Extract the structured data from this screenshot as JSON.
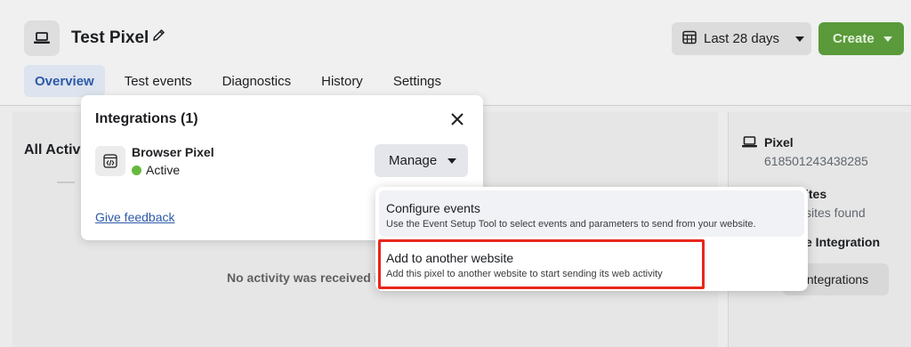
{
  "header": {
    "title": "Test Pixel",
    "date_range": "Last 28 days",
    "create_label": "Create"
  },
  "tabs": [
    {
      "label": "Overview",
      "active": true
    },
    {
      "label": "Test events"
    },
    {
      "label": "Diagnostics"
    },
    {
      "label": "History"
    },
    {
      "label": "Settings"
    }
  ],
  "main": {
    "section_title": "All Activi",
    "empty_message": "No activity was received i"
  },
  "side": {
    "pixel_title": "Pixel",
    "pixel_id": "618501243438285",
    "sites_title": "ites",
    "sites_sub": "sites found",
    "integration_title": "e Integration",
    "integrations_button": "Integrations"
  },
  "modal": {
    "title": "Integrations (1)",
    "integration_name": "Browser Pixel",
    "status": "Active",
    "manage_label": "Manage",
    "feedback_link": "Give feedback"
  },
  "dropdown": {
    "items": [
      {
        "label": "Configure events",
        "description": "Use the Event Setup Tool to select events and parameters to send from your website."
      },
      {
        "label": "Add to another website",
        "description": "Add this pixel to another website to start sending its web activity"
      }
    ]
  },
  "colors": {
    "create_green": "#5a9a3a",
    "active_tab": "#2d5aa8",
    "status_green": "#67b93e",
    "highlight_red": "#e8261c"
  }
}
